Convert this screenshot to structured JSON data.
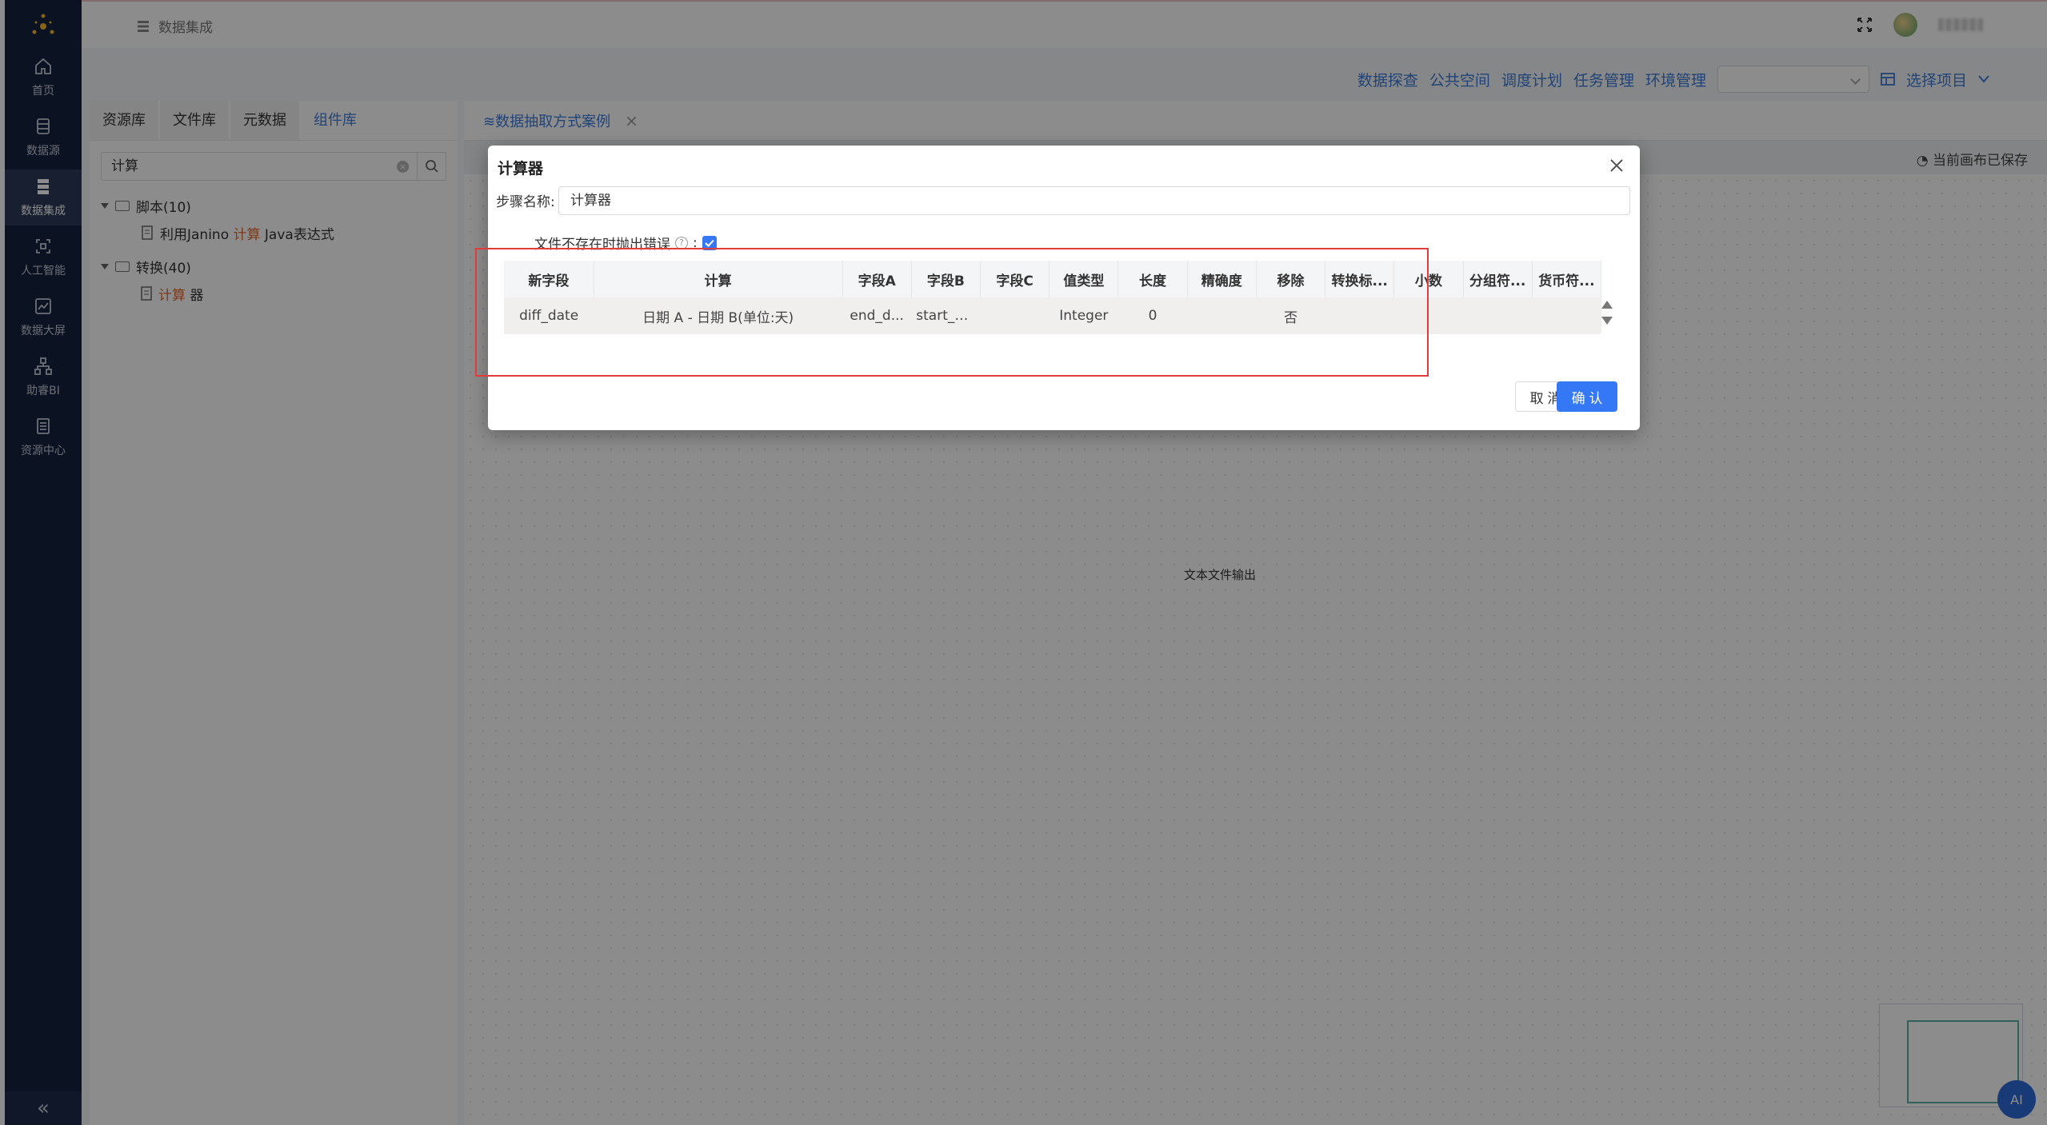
{
  "nav": {
    "items": [
      {
        "label": "首页",
        "icon": "home-icon"
      },
      {
        "label": "数据源",
        "icon": "database-icon"
      },
      {
        "label": "数据集成",
        "icon": "integration-icon"
      },
      {
        "label": "人工智能",
        "icon": "ai-icon"
      },
      {
        "label": "数据大屏",
        "icon": "chart-icon"
      },
      {
        "label": "助睿BI",
        "icon": "bi-icon"
      },
      {
        "label": "资源中心",
        "icon": "resource-icon"
      }
    ],
    "active": "数据集成",
    "collapse_glyph": "«"
  },
  "header": {
    "breadcrumb": "数据集成"
  },
  "subnav": {
    "links": [
      "数据探查",
      "公共空间",
      "调度计划",
      "任务管理",
      "环境管理"
    ],
    "project_select": "选择项目"
  },
  "leftpanel": {
    "tabs": [
      "资源库",
      "文件库",
      "元数据",
      "组件库"
    ],
    "active_tab": "组件库",
    "search_value": "计算",
    "tree": {
      "group1": "脚本(10)",
      "group1_child_pre": "利用Janino ",
      "group1_child_hl": "计算",
      "group1_child_post": " Java表达式",
      "group2": "转换(40)",
      "group2_child_hl": "计算",
      "group2_child_post": " 器"
    }
  },
  "canvas": {
    "tab_label": "数据抽取方式案例",
    "saved_status": "当前画布已保存",
    "node_label": "文本文件输出",
    "ai_label": "AI"
  },
  "dialog": {
    "title": "计算器",
    "step_label": "步骤名称:",
    "step_value": "计算器",
    "checkbox_label": "文件不存在时抛出错误",
    "columns": [
      "新字段",
      "计算",
      "字段A",
      "字段B",
      "字段C",
      "值类型",
      "长度",
      "精确度",
      "移除",
      "转换标...",
      "小数",
      "分组符...",
      "货币符..."
    ],
    "rows": [
      [
        "diff_date",
        "日期 A - 日期 B(单位:天)",
        "end_d...",
        "start_d...",
        "",
        "Integer",
        "0",
        "",
        "否",
        "",
        "",
        "",
        ""
      ]
    ],
    "cancel_label": "取 消",
    "ok_label": "确 认"
  },
  "colors": {
    "accent": "#3478f6",
    "nav_bg": "#14213d",
    "highlight": "#e6662c",
    "annotation": "#e23b3b"
  }
}
